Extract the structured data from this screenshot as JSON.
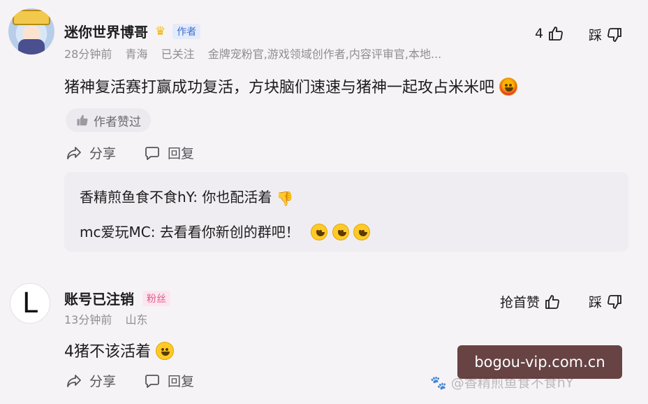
{
  "comment1": {
    "username": "迷你世界博哥",
    "author_badge": "作者",
    "likes": "4",
    "dislike_label": "踩",
    "meta": {
      "time": "28分钟前",
      "location": "青海",
      "follow_status": "已关注",
      "titles": "金牌宠粉官,游戏领域创作者,内容评审官,本地..."
    },
    "content": "猪神复活赛打赢成功复活，方块脑们速速与猪神一起攻占米米吧",
    "liked_chip": "作者赞过",
    "share_label": "分享",
    "reply_label": "回复",
    "replies": [
      {
        "user": "香精煎鱼食不食hY",
        "sep": ": ",
        "text": "你也配活着"
      },
      {
        "user": "mc爱玩MC",
        "sep": ": ",
        "text": "去看看你新创的群吧！"
      }
    ]
  },
  "comment2": {
    "avatar_letter": "L",
    "username": "账号已注销",
    "fan_badge": "粉丝",
    "like_label": "抢首赞",
    "dislike_label": "踩",
    "meta": {
      "time": "13分钟前",
      "location": "山东"
    },
    "content": "4猪不该活着",
    "share_label": "分享",
    "reply_label": "回复"
  },
  "watermark": {
    "site": "bogou-vip.com.cn",
    "credit": "@香精煎鱼食不食hY"
  },
  "icons": [
    "thumb-up-icon",
    "thumb-down-icon",
    "share-icon",
    "comment-icon",
    "crown-icon",
    "emoji-icon",
    "paw-icon"
  ],
  "colors": {
    "background": "#f6f3f6",
    "author_badge": "#3f6fd6",
    "fan_badge": "#e05b8a",
    "meta_text": "#8e8e93"
  }
}
